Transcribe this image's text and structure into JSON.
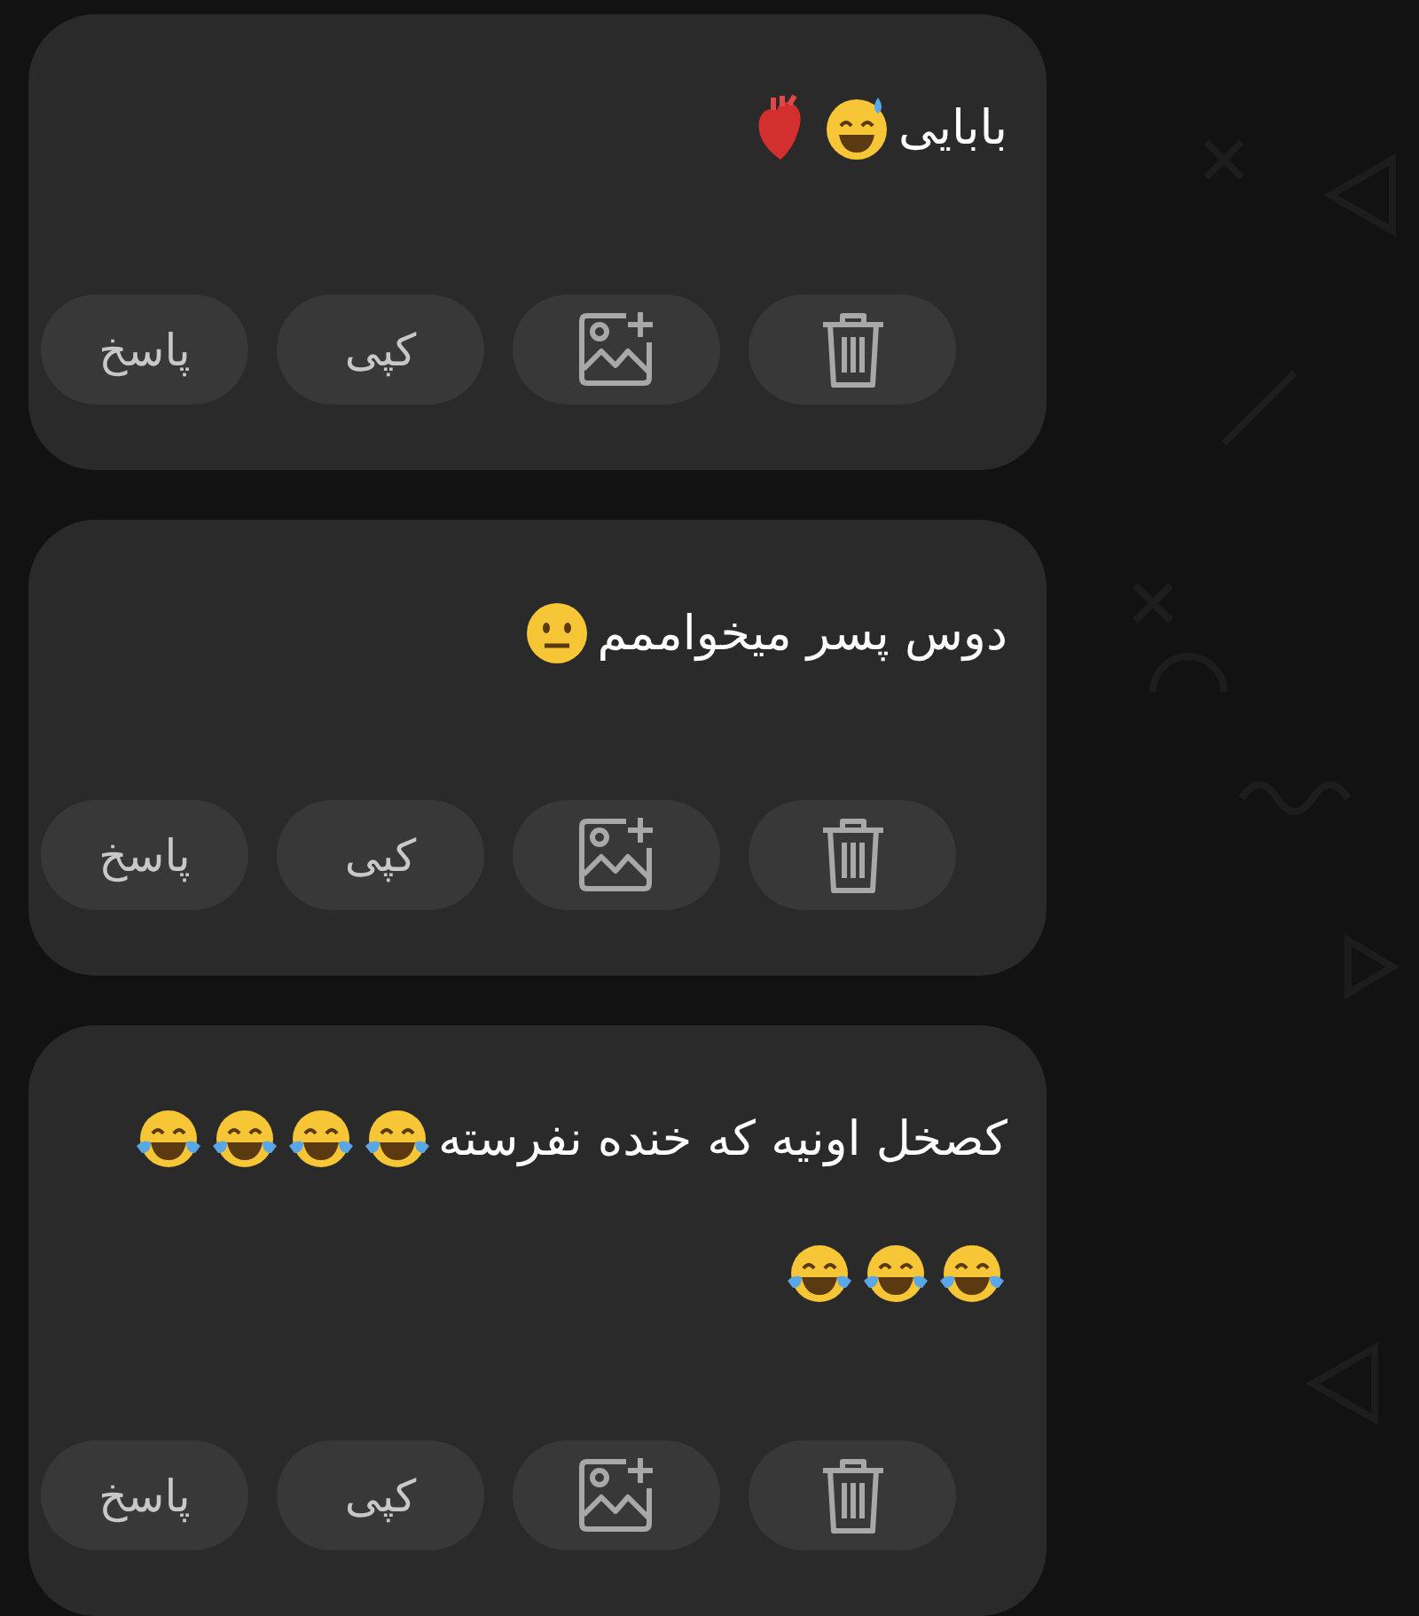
{
  "messages": [
    {
      "lines": [
        {
          "text": "بابایی",
          "emojis": [
            {
              "kind": "sweat-smile"
            },
            {
              "kind": "anatomical-heart"
            }
          ]
        }
      ],
      "actions": [
        {
          "kind": "delete"
        },
        {
          "kind": "add-image"
        },
        {
          "kind": "text",
          "label": "کپی"
        },
        {
          "kind": "text",
          "label": "پاسخ"
        }
      ]
    },
    {
      "lines": [
        {
          "text": "دوس پسر میخواممم",
          "emojis": [
            {
              "kind": "neutral-face"
            }
          ]
        }
      ],
      "actions": [
        {
          "kind": "delete"
        },
        {
          "kind": "add-image"
        },
        {
          "kind": "text",
          "label": "کپی"
        },
        {
          "kind": "text",
          "label": "پاسخ"
        }
      ]
    },
    {
      "lines": [
        {
          "text": "کصخل اونیه که خنده نفرسته",
          "emojis": [
            {
              "kind": "tears-of-joy"
            },
            {
              "kind": "tears-of-joy"
            },
            {
              "kind": "tears-of-joy"
            },
            {
              "kind": "tears-of-joy"
            }
          ]
        },
        {
          "emojis": [
            {
              "kind": "tears-of-joy"
            },
            {
              "kind": "tears-of-joy"
            },
            {
              "kind": "tears-of-joy"
            }
          ]
        }
      ],
      "actions": [
        {
          "kind": "delete"
        },
        {
          "kind": "add-image"
        },
        {
          "kind": "text",
          "label": "کپی"
        },
        {
          "kind": "text",
          "label": "پاسخ"
        }
      ]
    }
  ]
}
